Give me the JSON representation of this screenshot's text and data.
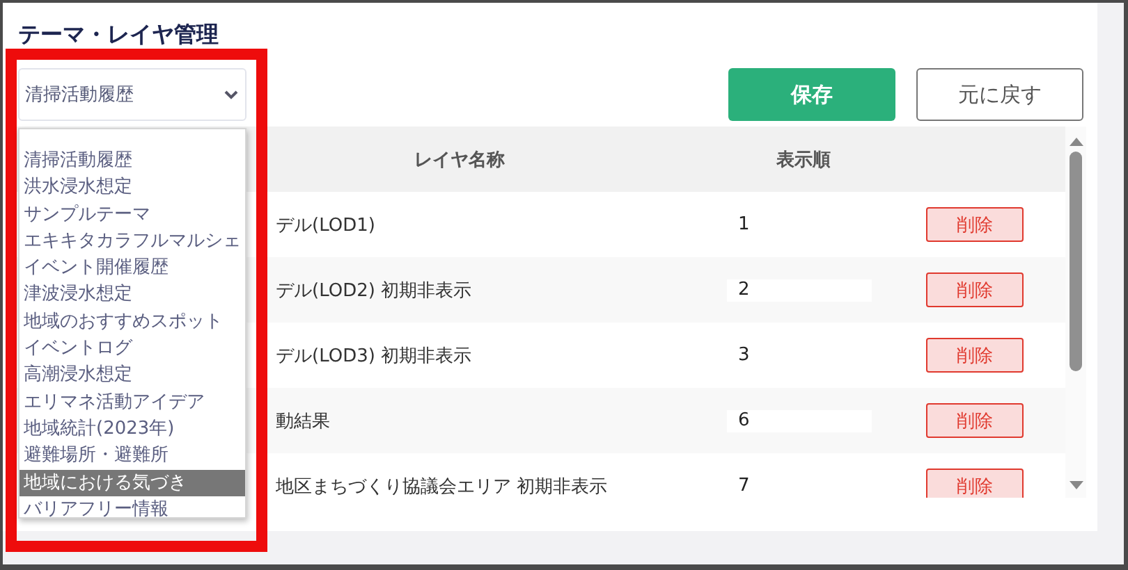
{
  "title": "テーマ・レイヤ管理",
  "theme_select": {
    "value": "清掃活動履歴",
    "options": [
      {
        "label": "清掃活動履歴",
        "highlighted": false
      },
      {
        "label": "洪水浸水想定",
        "highlighted": false
      },
      {
        "label": "サンプルテーマ",
        "highlighted": false
      },
      {
        "label": "エキキタカラフルマルシェ",
        "highlighted": false
      },
      {
        "label": "イベント開催履歴",
        "highlighted": false
      },
      {
        "label": "津波浸水想定",
        "highlighted": false
      },
      {
        "label": "地域のおすすめスポット",
        "highlighted": false
      },
      {
        "label": "イベントログ",
        "highlighted": false
      },
      {
        "label": "高潮浸水想定",
        "highlighted": false
      },
      {
        "label": "エリマネ活動アイデア",
        "highlighted": false
      },
      {
        "label": "地域統計(2023年)",
        "highlighted": false
      },
      {
        "label": "避難場所・避難所",
        "highlighted": false
      },
      {
        "label": "地域における気づき",
        "highlighted": true
      },
      {
        "label": "バリアフリー情報",
        "highlighted": false
      }
    ]
  },
  "buttons": [
    {
      "label": "保存",
      "kind": "primary"
    },
    {
      "label": "元に戻す",
      "kind": "secondary"
    }
  ],
  "table": {
    "columns": [
      "レイヤ名称",
      "表示順"
    ],
    "rows": [
      {
        "name": "デル(LOD1)",
        "order": "1",
        "action": "削除"
      },
      {
        "name": "デル(LOD2) 初期非表示",
        "order": "2",
        "action": "削除"
      },
      {
        "name": "デル(LOD3) 初期非表示",
        "order": "3",
        "action": "削除"
      },
      {
        "name": "動結果",
        "order": "6",
        "action": "削除"
      },
      {
        "name": "地区まちづくり協議会エリア 初期非表示",
        "order": "7",
        "action": "削除"
      }
    ]
  }
}
